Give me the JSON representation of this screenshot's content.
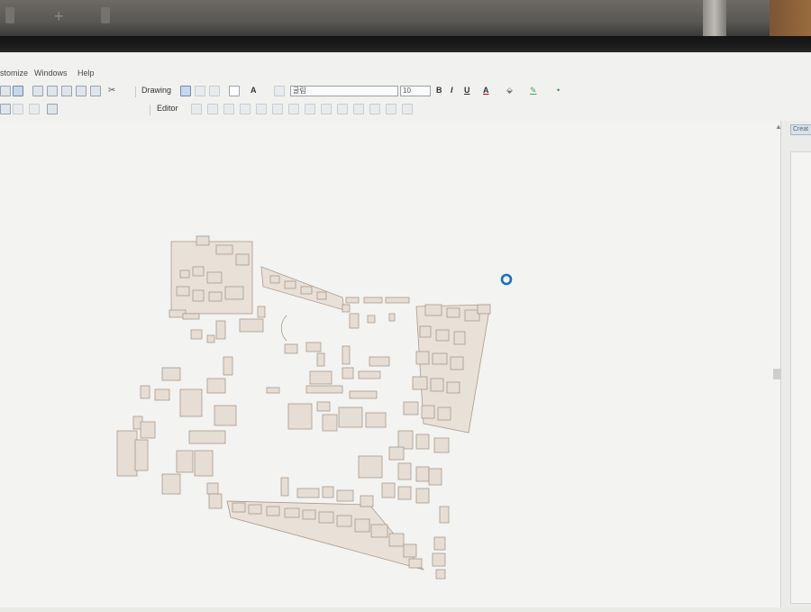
{
  "menu": {
    "items": [
      "stomize",
      "Windows",
      "Help"
    ]
  },
  "drawing_toolbar": {
    "drawing_label": "Drawing",
    "text_tool": "A",
    "font_name": "굴림",
    "font_size": "10",
    "bold": "B",
    "italic": "I",
    "underline": "U",
    "font_color": "A"
  },
  "editor_toolbar": {
    "editor_label": "Editor"
  },
  "right_panel": {
    "tab_label": "Creat"
  },
  "map": {
    "content": "building footprints polygon layer",
    "feature_fill": "#e6ddd4",
    "feature_stroke": "#a89a8d",
    "busy_cursor_color": "#1a6fc4"
  }
}
